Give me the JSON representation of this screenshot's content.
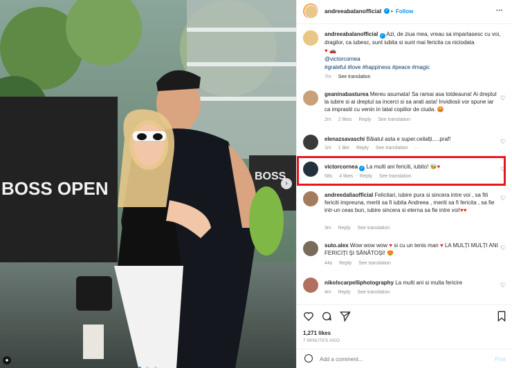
{
  "post": {
    "author": "andreeabalanofficial",
    "follow_label": "Follow",
    "more_label": "···",
    "photo_overlay": {
      "sign_left": "BOSS OPEN",
      "sign_right": "BOSS"
    }
  },
  "caption": {
    "author": "andreeabalanofficial",
    "line1": "Azi, de ziua mea, vreau sa impartasesc cu",
    "line2": "voi, dragilor, ca iubesc, sunt iubita si sunt mai fericita ca niciodata",
    "mention": "@victorcornea",
    "hashtags": "#grateful #love #happiness #peace #magic",
    "time": "7m",
    "see_translation": "See translation"
  },
  "comments": [
    {
      "user": "geaninabasturea",
      "text1": "Mereu asumata! Sa ramai asa totdeauna! Ai",
      "text2": "dreptul la iubire si ai dreptul sa incerci si sa arati asta! Invidiosii",
      "text3": "vor spune iar ca imprastii cu venin in tatal copiilor de ciuda.",
      "time": "2m",
      "likes": "2 likes",
      "reply": "Reply",
      "see_translation": "See translation"
    },
    {
      "user": "elenazsavaschi",
      "text1": "Băiatul asta e super.ceilalți.....praf!",
      "time": "1m",
      "likes": "1 like",
      "reply": "Reply",
      "see_translation": "See translation",
      "more": "···"
    },
    {
      "user": "victorcornea",
      "text1": "La multi ani fericiti, iubito!",
      "time": "58s",
      "likes": "4 likes",
      "reply": "Reply",
      "see_translation": "See translation"
    },
    {
      "user": "andreedaliaofficial",
      "text1": "Felicitari, iubire pura si sincera intre voi ,",
      "text2": "sa fiti fericiti impreuna, meriti sa fi iubita Andreea , meriti sa fi",
      "text3": "fericita , sa fie intr-un ceas bun, iubire sincera si eterna sa fie",
      "text4": "intre voi!",
      "time": "3m",
      "reply": "Reply",
      "see_translation": "See translation"
    },
    {
      "user": "suto.alex",
      "text1": "Wow wow wow",
      "text1b": "si cu un tenis man",
      "text1c": "LA MULȚI",
      "text2": "MULȚI ANI FERICIȚI ȘI SĂNĂTOȘI!",
      "time": "44s",
      "reply": "Reply",
      "see_translation": "See translation"
    },
    {
      "user": "nikolscarpelliphotography",
      "text1": "La multi ani si multa fericire",
      "time": "4m",
      "reply": "Reply",
      "see_translation": "See translation"
    }
  ],
  "actions": {
    "likes": "1,271 likes",
    "time": "7 MINUTES AGO"
  },
  "composer": {
    "placeholder": "Add a comment...",
    "post_label": "Post"
  },
  "colors": {
    "highlight": "#e8161b",
    "link": "#00376b",
    "accent": "#0095f6",
    "heart": "#ed1c24"
  }
}
